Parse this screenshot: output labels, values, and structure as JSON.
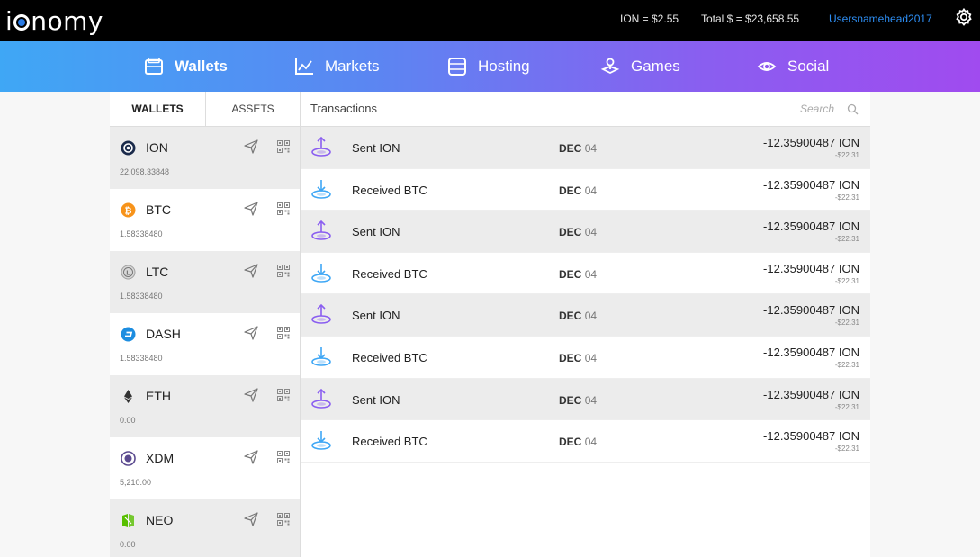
{
  "header": {
    "logo": "ionomy",
    "ion_price": "ION = $2.55",
    "total": "Total $ = $23,658.55",
    "username": "Usersnamehead2017",
    "settings_icon": "gear-icon"
  },
  "nav": {
    "items": [
      {
        "label": "Wallets",
        "icon": "wallet-icon",
        "active": true
      },
      {
        "label": "Markets",
        "icon": "chart-icon",
        "active": false
      },
      {
        "label": "Hosting",
        "icon": "server-icon",
        "active": false
      },
      {
        "label": "Games",
        "icon": "joystick-icon",
        "active": false
      },
      {
        "label": "Social",
        "icon": "eye-icon",
        "active": false
      }
    ]
  },
  "wallets": {
    "tabs": [
      "WALLETS",
      "ASSETS"
    ],
    "items": [
      {
        "name": "ION",
        "balance": "22,098.33848",
        "icon": "ion-coin-icon",
        "color": "#1b2b4b"
      },
      {
        "name": "BTC",
        "balance": "1.58338480",
        "icon": "btc-coin-icon",
        "color": "#f7931a"
      },
      {
        "name": "LTC",
        "balance": "1.58338480",
        "icon": "ltc-coin-icon",
        "color": "#9e9e9e"
      },
      {
        "name": "DASH",
        "balance": "1.58338480",
        "icon": "dash-coin-icon",
        "color": "#1c8de0"
      },
      {
        "name": "ETH",
        "balance": "0.00",
        "icon": "eth-coin-icon",
        "color": "#333333"
      },
      {
        "name": "XDM",
        "balance": "5,210.00",
        "icon": "xdm-coin-icon",
        "color": "#5b4a8f"
      },
      {
        "name": "NEO",
        "balance": "0.00",
        "icon": "neo-coin-icon",
        "color": "#58bf00"
      }
    ]
  },
  "transactions": {
    "title": "Transactions",
    "search_placeholder": "Search",
    "rows": [
      {
        "type": "sent",
        "label": "Sent ION",
        "month": "DEC",
        "day": "04",
        "amount": "-12.35900487 ION",
        "usd": "-$22.31"
      },
      {
        "type": "received",
        "label": "Received BTC",
        "month": "DEC",
        "day": "04",
        "amount": "-12.35900487 ION",
        "usd": "-$22.31"
      },
      {
        "type": "sent",
        "label": "Sent ION",
        "month": "DEC",
        "day": "04",
        "amount": "-12.35900487 ION",
        "usd": "-$22.31"
      },
      {
        "type": "received",
        "label": "Received BTC",
        "month": "DEC",
        "day": "04",
        "amount": "-12.35900487 ION",
        "usd": "-$22.31"
      },
      {
        "type": "sent",
        "label": "Sent ION",
        "month": "DEC",
        "day": "04",
        "amount": "-12.35900487 ION",
        "usd": "-$22.31"
      },
      {
        "type": "received",
        "label": "Received BTC",
        "month": "DEC",
        "day": "04",
        "amount": "-12.35900487 ION",
        "usd": "-$22.31"
      },
      {
        "type": "sent",
        "label": "Sent ION",
        "month": "DEC",
        "day": "04",
        "amount": "-12.35900487 ION",
        "usd": "-$22.31"
      },
      {
        "type": "received",
        "label": "Received BTC",
        "month": "DEC",
        "day": "04",
        "amount": "-12.35900487 ION",
        "usd": "-$22.31"
      }
    ]
  },
  "colors": {
    "accent_blue": "#2e8ff5",
    "sent_icon": "#8a5ef0",
    "received_icon": "#3fa7f5"
  }
}
